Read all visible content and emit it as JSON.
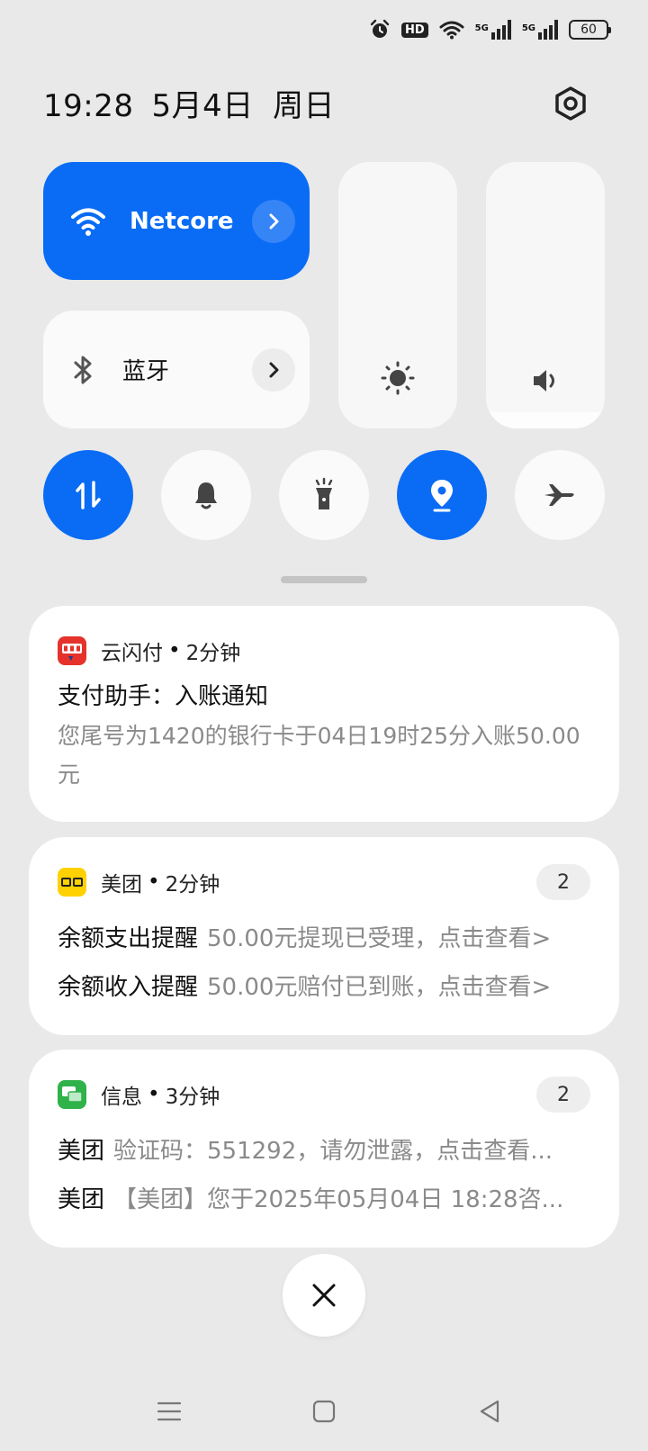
{
  "status": {
    "battery": "60",
    "hd": "HD",
    "net1": "5G",
    "net2": "5G"
  },
  "header": {
    "time": "19:28",
    "date": "5月4日",
    "weekday": "周日"
  },
  "wifi": {
    "label": "Netcore",
    "color": "#0a6cf5"
  },
  "bluetooth": {
    "label": "蓝牙"
  },
  "sliders": {
    "brightness_level": 0.0,
    "volume_level": 0.06
  },
  "notifications": [
    {
      "app": "云闪付",
      "time": "2分钟",
      "title": "支付助手：入账通知",
      "body": "您尾号为1420的银行卡于04日19时25分入账50.00元"
    },
    {
      "app": "美团",
      "time": "2分钟",
      "count": "2",
      "rows": [
        {
          "title": "余额支出提醒",
          "text": "50.00元提现已受理，点击查看>"
        },
        {
          "title": "余额收入提醒",
          "text": "50.00元赔付已到账，点击查看>"
        }
      ]
    },
    {
      "app": "信息",
      "time": "3分钟",
      "count": "2",
      "rows": [
        {
          "title": "美团",
          "text": "验证码：551292，请勿泄露，点击查看..."
        },
        {
          "title": "美团",
          "text": "【美团】您于2025年05月04日 18:28咨..."
        }
      ]
    }
  ],
  "separator": "•"
}
